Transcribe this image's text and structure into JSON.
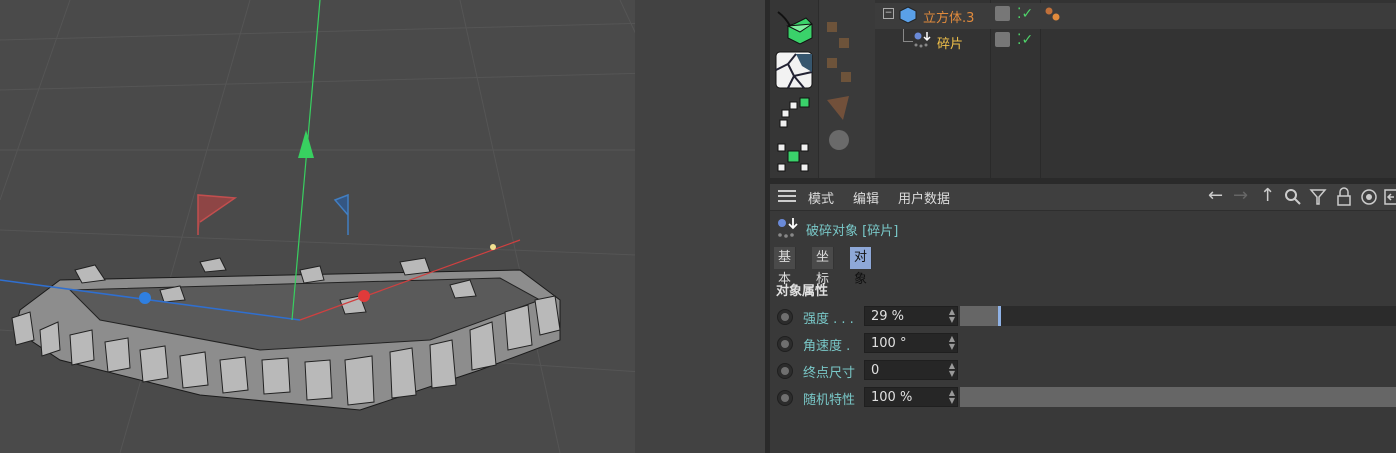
{
  "object_manager": {
    "rows": [
      {
        "name": "立方体.3",
        "color": "#e08a3c"
      },
      {
        "name": "碎片",
        "color": "#f0c04a"
      }
    ]
  },
  "attributes": {
    "menu": [
      "模式",
      "编辑",
      "用户数据"
    ],
    "object_title": "破碎对象 [碎片]",
    "tabs": [
      "基本",
      "坐标",
      "对象"
    ],
    "active_tab": "对象",
    "section": "对象属性",
    "params": [
      {
        "label": "强度 . . .",
        "value": "29 %",
        "slider": 0.29
      },
      {
        "label": "角速度 .",
        "value": "100 °"
      },
      {
        "label": "终点尺寸",
        "value": "0"
      },
      {
        "label": "随机特性",
        "value": "100 %",
        "slider": 1.0
      }
    ]
  },
  "colors": {
    "accent": "#8ea8d8",
    "param_label": "#79c8c8",
    "check": "#4fd46a"
  }
}
